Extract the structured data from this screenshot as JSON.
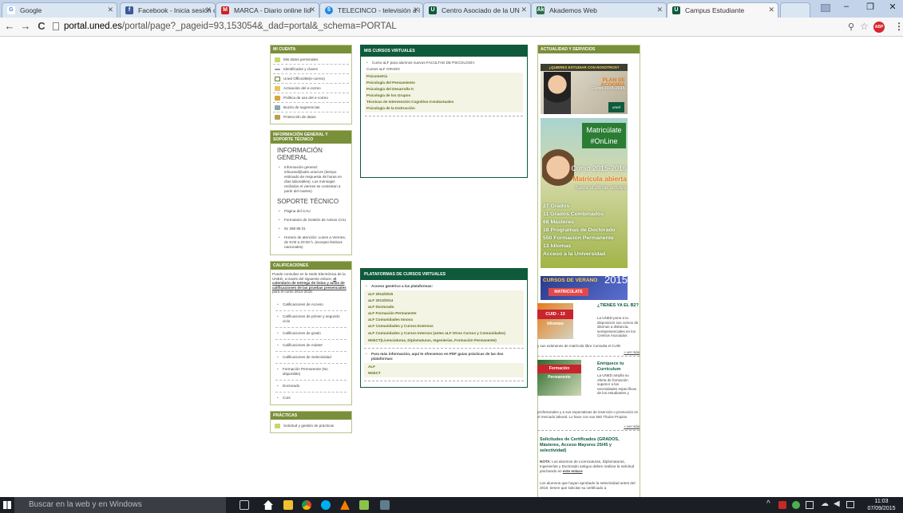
{
  "browser": {
    "tabs": [
      {
        "label": "Google",
        "color": "#4285f4",
        "glyph": "G"
      },
      {
        "label": "Facebook - Inicia sesión o",
        "color": "#3b5998",
        "glyph": "f"
      },
      {
        "label": "MARCA - Diario online líd",
        "color": "#d02020",
        "glyph": "M"
      },
      {
        "label": "TELECINCO - televisión a l",
        "color": "#1e88e5",
        "glyph": "5"
      },
      {
        "label": "Centro Asociado de la UN",
        "color": "#0f5a3b",
        "glyph": "U"
      },
      {
        "label": "Akademos Web",
        "color": "#0f5a3b",
        "glyph": "Ak"
      },
      {
        "label": "Campus Estudiante",
        "color": "#0f5a3b",
        "glyph": "U"
      }
    ],
    "url_host": "portal.uned.es",
    "url_path": "/portal/page?_pageid=93,153054&_dad=portal&_schema=PORTAL"
  },
  "mi_cuenta": {
    "title": "MI CUENTA",
    "items": [
      "Mis datos personales",
      "Identificador y claves",
      "Uned Office365(e-correo)",
      "Activación del e-correo",
      "Política de uso del e-correo",
      "Buzón de sugerencias",
      "Protección de datos"
    ]
  },
  "info": {
    "title": "INFORMACIÓN GENERAL Y SOPORTE TÉCNICO",
    "general_title": "INFORMACIÓN GENERAL",
    "general_text": "Información general: infouned@adm.uned.es (tiempo estimado de respuesta 48 horas en días laborables). Los mensajes recibidos el viernes se contestan a partir del martes)",
    "soporte_title": "SOPORTE TÉCNICO",
    "soporte_items": [
      "Página del CAU",
      "Formulario de Gestión de Avisos CAU",
      "91 398 88 01",
      "Horario de atención: Lunes a Viernes, de 9:00 a 20:00 h. (excepto festivos nacionales)"
    ]
  },
  "calificaciones": {
    "title": "CALIFICACIONES",
    "intro_a": "Puede consultar en la Sede Electrónica de la UNED, a través del siguiente enlace,",
    "intro_link": "el calendario de entrega de listas y actas de calificaciones de las pruebas presenciales",
    "intro_b": "para el curso 2014-2015.",
    "items": [
      "Calificaciones de Acceso",
      "Calificaciones de primer y segundo ciclo",
      "Calificaciones de grado",
      "Calificaciones de máster",
      "Calificaciones de Selectividad",
      "Formación Permanente (No disponible)",
      "Doctorado",
      "Curs"
    ]
  },
  "practicas": {
    "title": "PRÁCTICAS",
    "items": [
      "Solicitud y gestión de prácticas"
    ]
  },
  "cursos": {
    "title": "MIS CURSOS VIRTUALES",
    "intro": "Curso aLF para alumnos nuevos FACULTAD DE PSICOLOGÍA",
    "sub": "Cursos aLF GRADO",
    "items": [
      "Psicometría",
      "Psicología del Pensamiento",
      "Psicología del Desarrollo II",
      "Psicología de los Grupos",
      "Técnicas de Intervención Cognitivo-Conductuales",
      "Psicología de la Instrucción"
    ]
  },
  "plataformas": {
    "title": "PLATAFORMAS DE CURSOS VIRTUALES",
    "acceso": "Acceso genérico a las plataformas:",
    "items": [
      "aLF 2014/2015",
      "aLF 2013/2014",
      "aLF Doctorado",
      "aLF Formación Permanente",
      "aLF Comunidades Innova",
      "aLF Comunidades y Cursos Externos",
      "aLF Comunidades y Cursos Internos (antes aLF Otros Cursos y Comunidades)",
      "WebCT(Licenciaturas, Diplomaturas, Ingenierías, Formación Permanente)"
    ],
    "info": "Para más información, aquí te ofrecemos en PDF guías prácticas de las dos plataformas:",
    "info_items": [
      "ALF",
      "WebCT"
    ]
  },
  "actualidad": {
    "title": "ACTUALIDAD Y SERVICIOS",
    "banner1_q": "¿QUIERES ESTUDIAR CON NOSOTROS?",
    "banner1_plan": "PLAN DE ACOGIDA",
    "banner1_curso": "Curso 2015-2016",
    "banner1_logo": "uned",
    "banner2_title1": "Matricúlate",
    "banner2_title2": "#OnLine",
    "banner2_curso": "Curso 2015-2016",
    "banner2_abierta": "Matrícula abierta",
    "banner2_fecha": "hasta el 26 de octubre",
    "banner2_list": [
      "27 Grados",
      "11 Grados Combinados",
      "68 Másteres",
      "18 Programas de Doctorado",
      "550 Formación Permanente",
      "13 Idiomas",
      "Acceso a la Universidad"
    ],
    "verano_title": "CURSOS DE VERANO",
    "verano_year": "2015",
    "verano_btn": "MATRICÚLATE",
    "cuid_img": "CUID - 13 Idiomas",
    "cuid_title": "¿TIENES YA EL B2?",
    "cuid_text": "La UNED pone a tu disposición sus cursos de idiomas a distancia, semipresenciales en los Centros Asociados",
    "cuid_text2": "y sus exámenes de matrícula libre Consulta el CUID",
    "ver_mas": "» ver más",
    "fp_img": "Formación Permanente",
    "fp_title": "Enriquece tu Currículum",
    "fp_text": "La UNED amplía su oferta de formación superior a las necesidades específicas de los estudiantes y",
    "fp_text2": "profesionales y a sus expectativas de inserción o promoción en el mercado laboral. Lo hace con sus 550 Títulos Propios",
    "cert_title": "Solicitudes de Certificados (GRADOS, Másteres, Acceso Mayores 25/45 y selectividad)",
    "nota_label": "NOTA",
    "nota_text": "Los alumnos de Licenciaturas, Diplomaturas, Ingenierías y Doctorado antiguo deben realizar la solicitud pinchando en",
    "nota_link": "este enlace",
    "nota_text2": "Los alumnos que hayan aprobado la selectividad antes del 2010, tienen que solicitar su certificado a"
  },
  "taskbar": {
    "search": "Buscar en la web y en Windows",
    "time": "11:03",
    "date": "07/09/2015"
  }
}
